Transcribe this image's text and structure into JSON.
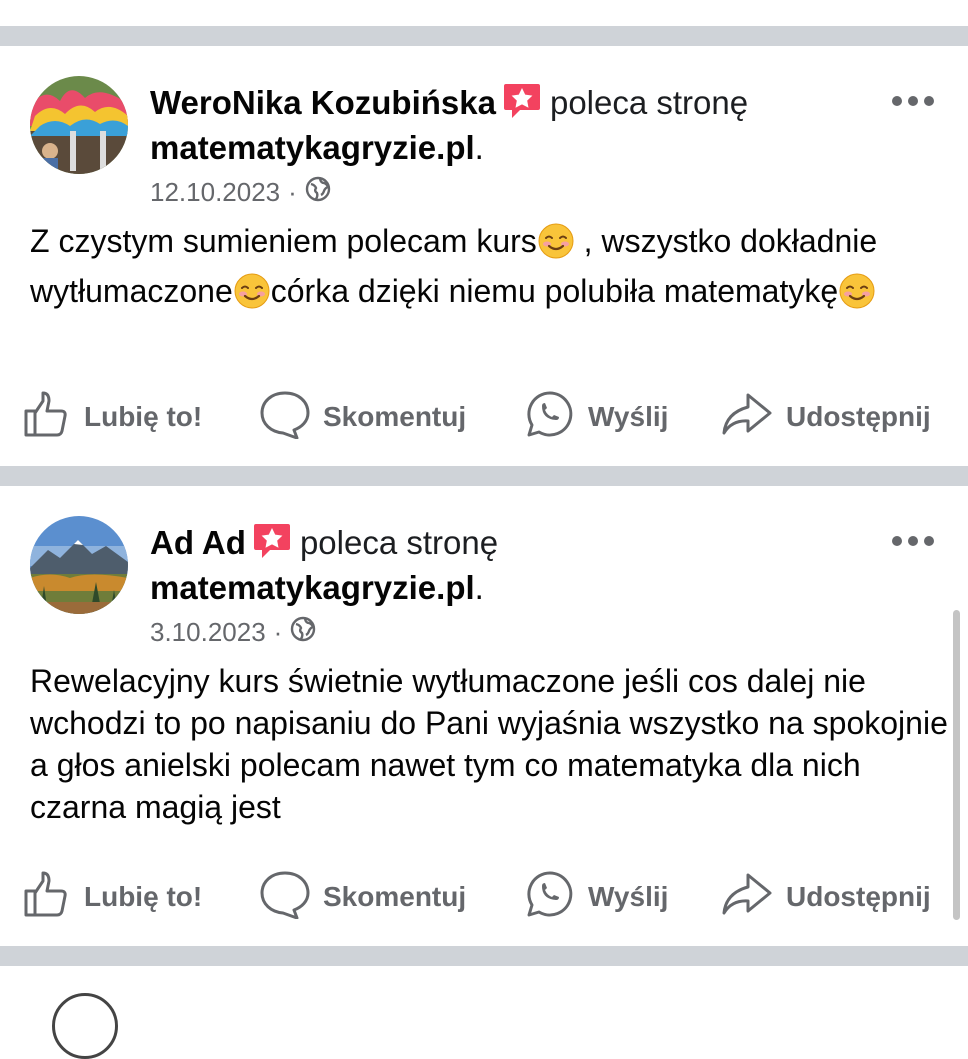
{
  "posts": [
    {
      "author": "WeroNika Kozubińska",
      "verb": "poleca stronę",
      "page": "matematykagryzie.pl",
      "page_suffix": ".",
      "date": "12.10.2023",
      "separator": "·",
      "text_parts": [
        "Z czystym sumieniem polecam kurs",
        " , wszystko dokładnie wytłumaczone",
        "córka dzięki niemu polubiła matematykę"
      ],
      "avatar_icon": "umbrellas-photo"
    },
    {
      "author": "Ad Ad",
      "verb": "poleca stronę",
      "page": "matematykagryzie.pl",
      "page_suffix": ".",
      "date": "3.10.2023",
      "separator": "·",
      "text": "Rewelacyjny kurs świetnie wytłumaczone jeśli cos dalej nie wchodzi to po napisaniu do Pani wyjaśnia wszystko na spokojnie a głos anielski  polecam nawet tym co matematyka dla nich czarna magią jest",
      "avatar_icon": "mountain-photo"
    }
  ],
  "actions": {
    "like": "Lubię to!",
    "comment": "Skomentuj",
    "send": "Wyślij",
    "share": "Udostępnij"
  },
  "colors": {
    "accent_recommend": "#f3425f",
    "muted": "#65676b",
    "divider": "#cfd3d8"
  }
}
